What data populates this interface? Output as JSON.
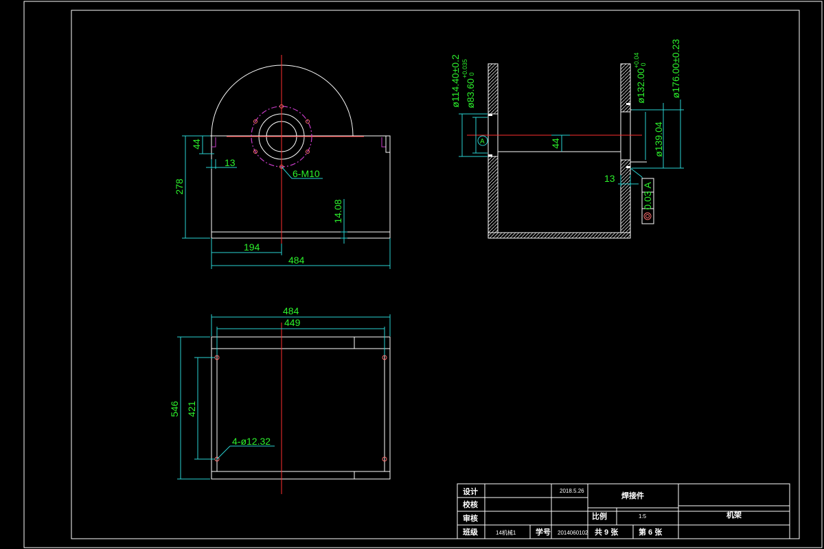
{
  "front_view": {
    "dim_278": "278",
    "dim_44": "44",
    "dim_13": "13",
    "thread_label": "6-M10",
    "dim_14_08": "14.08",
    "dim_194": "194",
    "dim_484": "484"
  },
  "top_view": {
    "dim_484": "484",
    "dim_449": "449",
    "dim_546": "546",
    "dim_421": "421",
    "hole_label": "4-ø12.32"
  },
  "section_view": {
    "dia_114": "ø114.40±0.2",
    "dia_83": "ø83.60",
    "dia_83_tol_upper": "+0.035",
    "dia_83_tol_lower": "0",
    "datum_label": "A",
    "dim_44": "44",
    "dia_132": "ø132.00",
    "dia_132_tol_upper": "+0.04",
    "dia_132_tol_lower": "0",
    "dia_176": "ø176.00±0.23",
    "dia_139": "ø139.04",
    "dim_13": "13",
    "tolerance_value": "0.03",
    "tolerance_datum": "A"
  },
  "title_block": {
    "design_label": "设计",
    "check_label": "校核",
    "review_label": "审核",
    "class_label": "班级",
    "design_date": "2018.5.26",
    "part_title": "焊接件",
    "scale_label": "比例",
    "scale_value": "1:5",
    "class_value": "14机械1",
    "student_no_label": "学号",
    "student_no_value": "2014060102",
    "total_label": "共 9 张",
    "sheet_label": "第 6 张",
    "drawing_name": "机架"
  }
}
